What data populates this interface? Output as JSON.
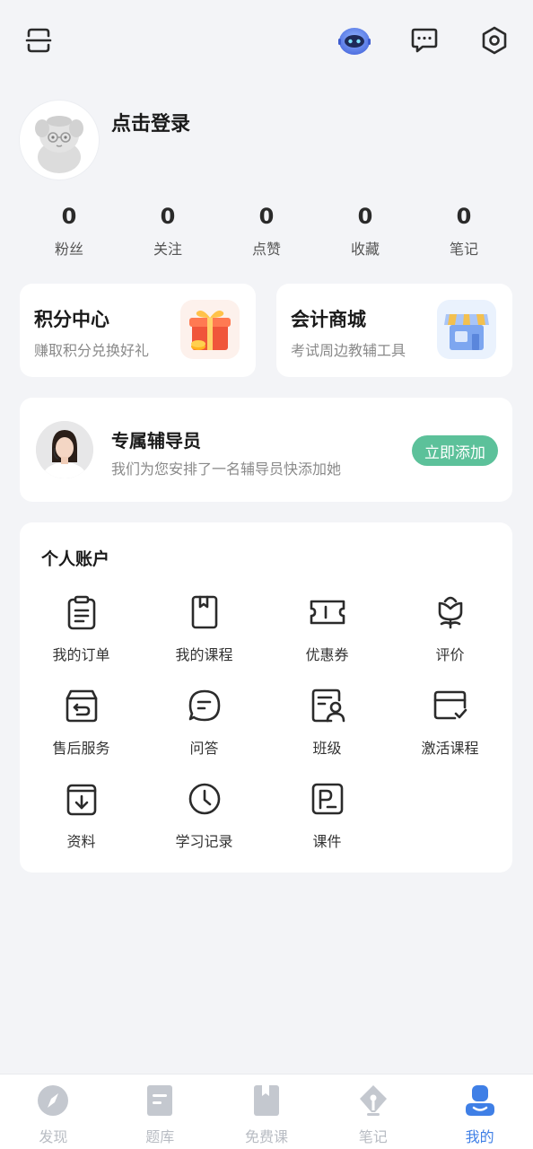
{
  "header": {
    "icons": [
      "scan-icon",
      "robot-assistant-icon",
      "message-icon",
      "settings-icon"
    ]
  },
  "profile": {
    "login_text": "点击登录"
  },
  "stats": [
    {
      "value": "0",
      "label": "粉丝"
    },
    {
      "value": "0",
      "label": "关注"
    },
    {
      "value": "0",
      "label": "点赞"
    },
    {
      "value": "0",
      "label": "收藏"
    },
    {
      "value": "0",
      "label": "笔记"
    }
  ],
  "promos": [
    {
      "title": "积分中心",
      "subtitle": "赚取积分兑换好礼",
      "icon": "gift-box-icon"
    },
    {
      "title": "会计商城",
      "subtitle": "考试周边教辅工具",
      "icon": "store-icon"
    }
  ],
  "tutor": {
    "title": "专属辅导员",
    "subtitle": "我们为您安排了一名辅导员快添加她",
    "button": "立即添加"
  },
  "account": {
    "title": "个人账户",
    "items": [
      {
        "label": "我的订单",
        "icon": "order-clipboard-icon"
      },
      {
        "label": "我的课程",
        "icon": "course-book-icon"
      },
      {
        "label": "优惠券",
        "icon": "coupon-icon"
      },
      {
        "label": "评价",
        "icon": "flower-rating-icon"
      },
      {
        "label": "售后服务",
        "icon": "after-sales-box-icon"
      },
      {
        "label": "问答",
        "icon": "chat-bubble-icon"
      },
      {
        "label": "班级",
        "icon": "class-person-icon"
      },
      {
        "label": "激活课程",
        "icon": "activate-card-icon"
      },
      {
        "label": "资料",
        "icon": "download-materials-icon"
      },
      {
        "label": "学习记录",
        "icon": "clock-history-icon"
      },
      {
        "label": "课件",
        "icon": "courseware-icon"
      }
    ]
  },
  "tabbar": {
    "tabs": [
      {
        "label": "发现",
        "icon": "compass-icon",
        "active": false
      },
      {
        "label": "题库",
        "icon": "question-bank-icon",
        "active": false
      },
      {
        "label": "免费课",
        "icon": "free-course-icon",
        "active": false
      },
      {
        "label": "笔记",
        "icon": "pen-nib-icon",
        "active": false
      },
      {
        "label": "我的",
        "icon": "profile-icon",
        "active": true
      }
    ]
  },
  "colors": {
    "background": "#f3f4f7",
    "accent_green": "#5cc19a",
    "active_tab": "#3f7fe6",
    "inactive_tab": "#b8bcc3"
  }
}
